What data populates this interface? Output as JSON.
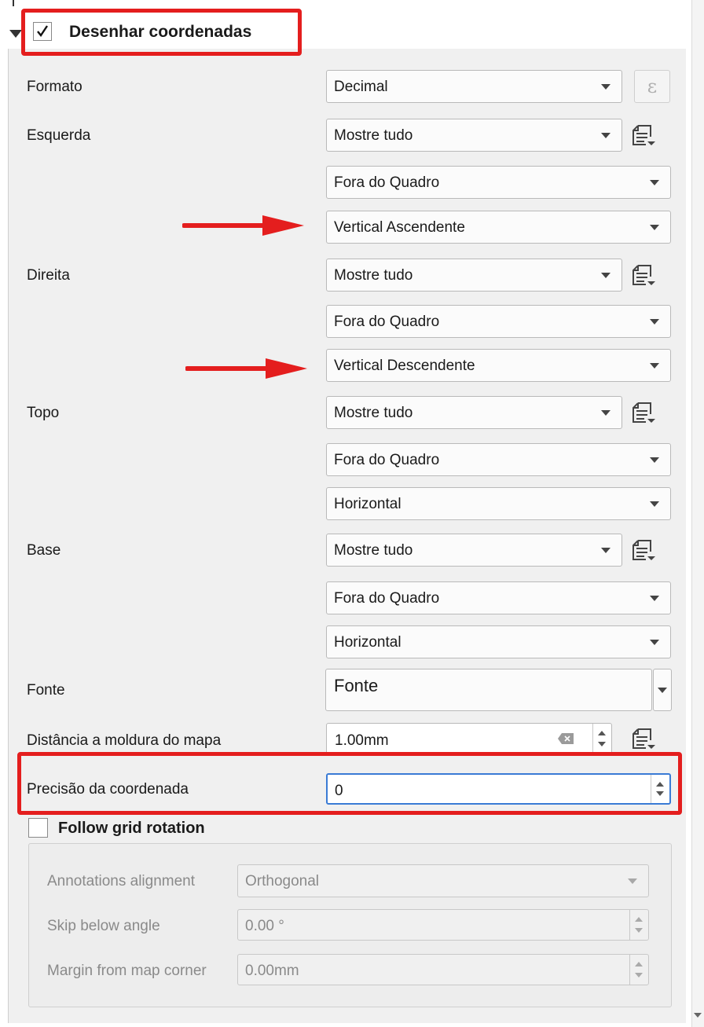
{
  "section": {
    "title": "Desenhar coordenadas",
    "checked": true
  },
  "format": {
    "label": "Formato",
    "value": "Decimal",
    "expr_icon": "epsilon-icon"
  },
  "left": {
    "label": "Esquerda",
    "display": "Mostre tudo",
    "position": "Fora do Quadro",
    "direction": "Vertical Ascendente"
  },
  "right": {
    "label": "Direita",
    "display": "Mostre tudo",
    "position": "Fora do Quadro",
    "direction": "Vertical Descendente"
  },
  "top": {
    "label": "Topo",
    "display": "Mostre tudo",
    "position": "Fora do Quadro",
    "direction": "Horizontal"
  },
  "bottom": {
    "label": "Base",
    "display": "Mostre tudo",
    "position": "Fora do Quadro",
    "direction": "Horizontal"
  },
  "font": {
    "label": "Fonte",
    "button": "Fonte"
  },
  "distance": {
    "label": "Distância a moldura do mapa",
    "value": "1.00mm"
  },
  "precision": {
    "label": "Precisão da coordenada",
    "value": "0"
  },
  "follow": {
    "label": "Follow grid rotation",
    "checked": false,
    "alignment_label": "Annotations alignment",
    "alignment_value": "Orthogonal",
    "skip_label": "Skip below angle",
    "skip_value": "0.00 °",
    "margin_label": "Margin from map corner",
    "margin_value": "0.00mm"
  },
  "colors": {
    "highlight": "#e41e1e",
    "focus": "#3a7bd5"
  }
}
